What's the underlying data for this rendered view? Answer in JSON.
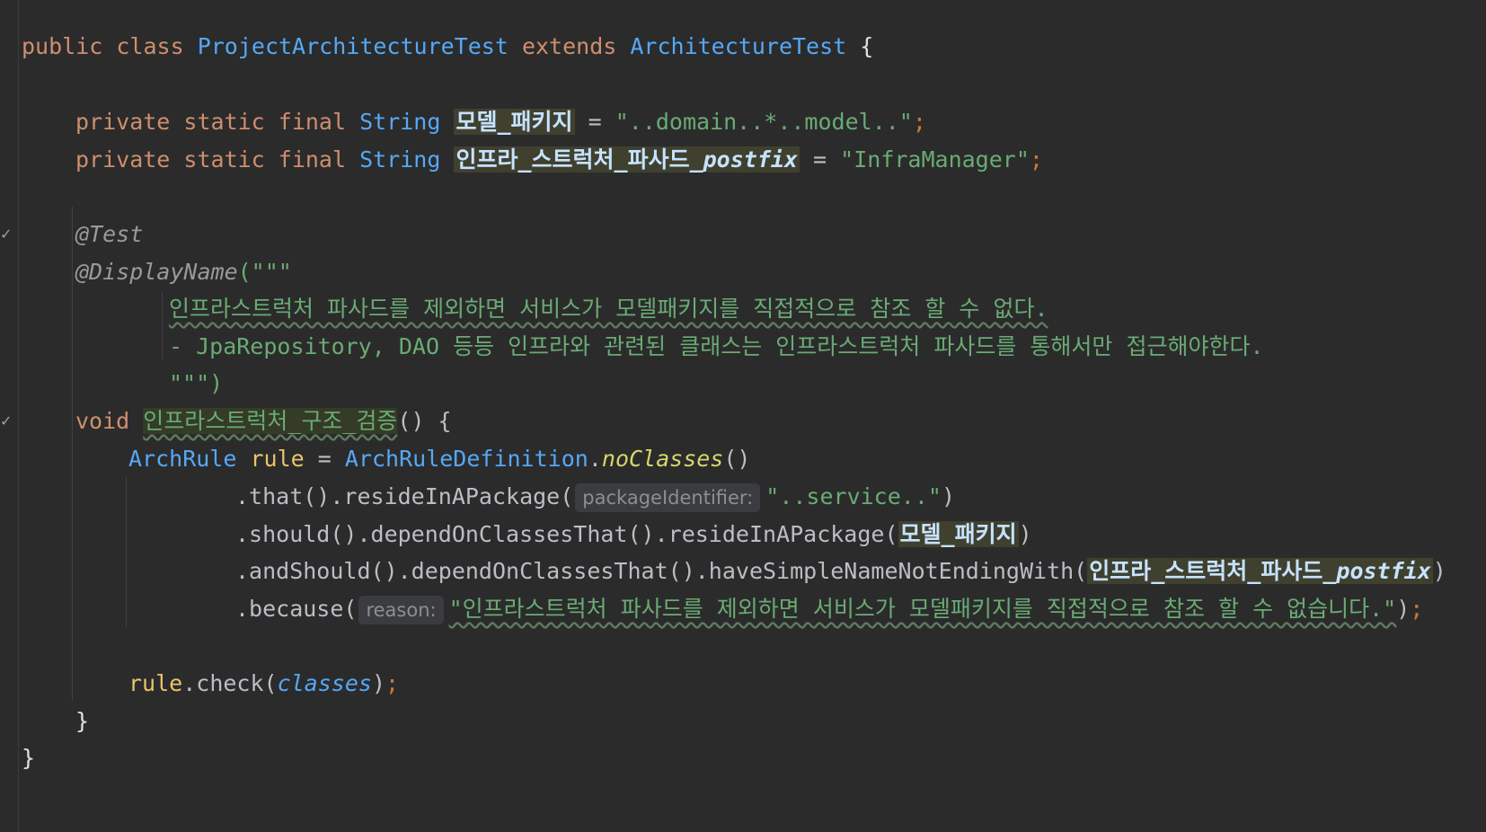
{
  "code": {
    "l1": {
      "kw1": "public",
      "kw2": "class",
      "name": "ProjectArchitectureTest",
      "kw3": "extends",
      "parent": "ArchitectureTest",
      "brace": "{"
    },
    "l2": {
      "kw": "private static final",
      "type": "String",
      "field": "모델_패키지",
      "eq": "=",
      "value": "\"..domain..*..model..\"",
      "semi": ";"
    },
    "l3": {
      "kw": "private static final",
      "type": "String",
      "field": "인프라_스트럭처_파사드_",
      "field_suffix": "postfix",
      "eq": "=",
      "value": "\"InfraManager\"",
      "semi": ";"
    },
    "l4": {
      "anno": "@Test"
    },
    "l5": {
      "anno": "@DisplayName",
      "open": "(\"\"\""
    },
    "l6": {
      "text": "인프라스트럭처 파사드를 제외하면 서비스가 모델패키지를 직접적으로 참조 할 수 없다."
    },
    "l7": {
      "text": "- JpaRepository, DAO 등등 인프라와 관련된 클래스는 인프라스트럭처 파사드를 통해서만 접근해야한다."
    },
    "l8": {
      "close": "\"\"\")"
    },
    "l9": {
      "kw": "void",
      "name": "인프라스트럭처_구조_검증",
      "rest": "() {"
    },
    "l10": {
      "type": "ArchRule",
      "var": "rule",
      "eq": "=",
      "cls": "ArchRuleDefinition",
      "dot": ".",
      "method": "noClasses",
      "paren": "()"
    },
    "l11": {
      "chain": ".that().resideInAPackage(",
      "hint": "packageIdentifier:",
      "value": "\"..service..\"",
      "close": ")"
    },
    "l12": {
      "chain": ".should().dependOnClassesThat().resideInAPackage(",
      "field": "모델_패키지",
      "close": ")"
    },
    "l13": {
      "chain": ".andShould().dependOnClassesThat().haveSimpleNameNotEndingWith(",
      "field": "인프라_스트럭처_파사드_",
      "field_suffix": "postfix",
      "close": ")"
    },
    "l14": {
      "chain": ".because(",
      "hint": "reason:",
      "value": "\"인프라스트럭처 파사드를 제외하면 서비스가 모델패키지를 직접적으로 참조 할 수 없습니다.\"",
      "close": ")",
      "semi": ";"
    },
    "l15": {
      "var": "rule",
      "call": ".check(",
      "arg": "classes",
      "close": ")",
      "semi": ";"
    },
    "l16": {
      "brace": "}"
    },
    "l17": {
      "brace": "}"
    }
  },
  "gutter": {
    "check_icon": "checkmark-icon"
  },
  "colors": {
    "background": "#2b2b2c",
    "keyword": "#cf8e6d",
    "class_name": "#56a8f5",
    "string": "#6aab73",
    "field_highlight_bg": "#40402f"
  }
}
